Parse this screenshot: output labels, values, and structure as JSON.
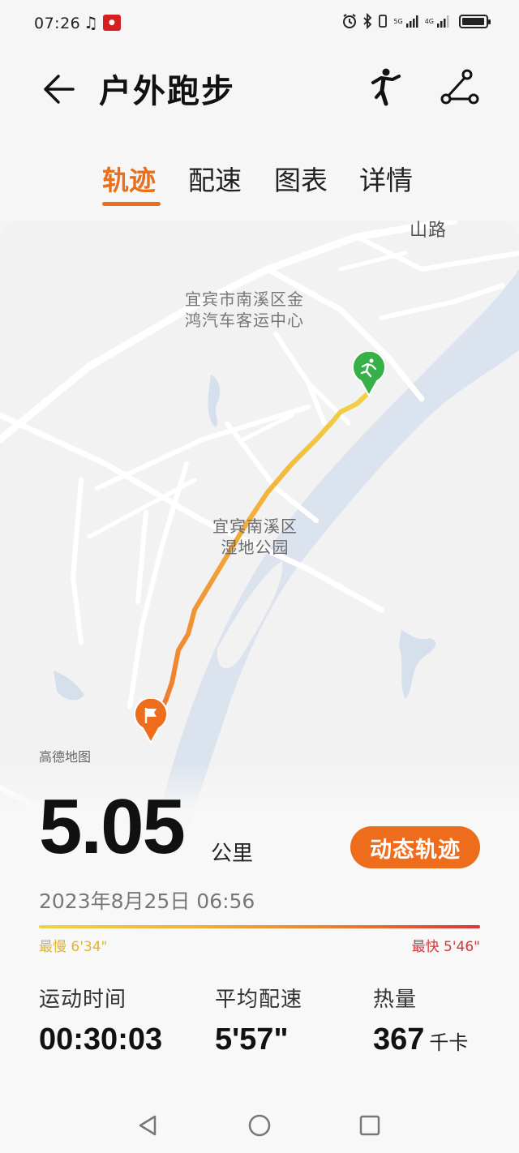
{
  "status_bar": {
    "time": "07:26",
    "icons": [
      "music-note-icon",
      "app-badge-icon",
      "alarm-icon",
      "bluetooth-icon",
      "vibrate-icon",
      "signal-5g-icon",
      "signal-4g-icon",
      "battery-icon"
    ],
    "network_labels": [
      "5G",
      "4G"
    ],
    "battery_level": 0.95
  },
  "header": {
    "back_icon": "arrow-left-icon",
    "title": "户外跑步",
    "right_icons": [
      "runner-pose-icon",
      "share-route-icon"
    ]
  },
  "tabs": [
    {
      "label": "轨迹",
      "active": true
    },
    {
      "label": "配速",
      "active": false
    },
    {
      "label": "图表",
      "active": false
    },
    {
      "label": "详情",
      "active": false
    }
  ],
  "map": {
    "labels": {
      "road_fragment": "山路",
      "poi_bus_station": "宜宾市南溪区金\n鸿汽车客运中心",
      "poi_wetland_park": "宜宾南溪区\n湿地公园"
    },
    "credit": "高德地图",
    "start_marker_icon": "running-man-marker-icon",
    "end_marker_icon": "flag-marker-icon",
    "colors": {
      "water": "#dbe3ee",
      "route_start": "#f2cf3e",
      "route_end": "#ee7a2c",
      "start_marker": "#37b04a",
      "end_marker": "#ee6d1d"
    }
  },
  "summary": {
    "distance": "5.05",
    "distance_unit": "公里",
    "dynamic_track_button": "动态轨迹",
    "date": "2023年8月25日 06:56",
    "slowest": "最慢 6'34\"",
    "fastest": "最快 5'46\""
  },
  "stats": [
    {
      "label": "运动时间",
      "value": "00:30:03",
      "unit": ""
    },
    {
      "label": "平均配速",
      "value": "5'57\"",
      "unit": ""
    },
    {
      "label": "热量",
      "value": "367",
      "unit": "千卡"
    }
  ],
  "nav_bar": [
    "back-triangle-icon",
    "home-circle-icon",
    "recents-square-icon"
  ]
}
